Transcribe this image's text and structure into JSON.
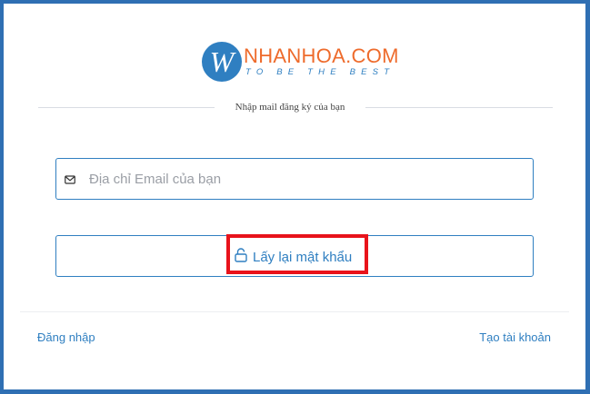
{
  "brand": {
    "logo_letter": "W",
    "name": "NHANHOA.COM",
    "tagline": "TO BE THE BEST",
    "colors": {
      "primary": "#2f7fc1",
      "accent": "#ee6b2c",
      "frame": "#2f6fb3",
      "highlight": "#e8131b"
    }
  },
  "form": {
    "divider_text": "Nhập mail đăng ký của bạn",
    "email": {
      "icon": "mail-icon",
      "placeholder": "Địa chỉ Email của bạn",
      "value": ""
    },
    "reset_button": {
      "icon": "unlock-icon",
      "label": "Lấy lại mật khẩu"
    }
  },
  "footer": {
    "login_link": "Đăng nhập",
    "register_link": "Tạo tài khoản"
  }
}
